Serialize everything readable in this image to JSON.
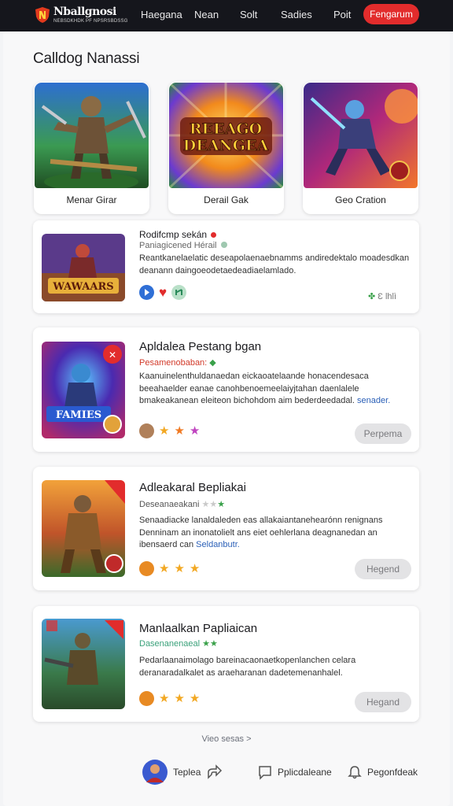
{
  "header": {
    "brand_name": "Nballgnosi",
    "brand_tagline": "NEBSDKHDK PF NPSRSBDSSG",
    "nav": [
      "Haegana",
      "Nean",
      "Solt",
      "Sadies",
      "Poit"
    ],
    "cta_label": "Fengarum"
  },
  "page_title": "Calldog Nanassi",
  "featured": [
    {
      "label": "Menar Girar",
      "art_text": "",
      "icon": "warrior-art"
    },
    {
      "label": "Derail Gak",
      "art_text_line1": "REEAGO",
      "art_text_line2": "DEANGEA",
      "icon": "logo-art"
    },
    {
      "label": "Geo Cration",
      "art_text": "",
      "icon": "knight-art"
    }
  ],
  "cards": [
    {
      "title": "Rodifcmp sekán",
      "subtitle": "Paniagicened Hérail",
      "description": "Reantkanelaelatic deseapolaenaebnamms andiredektalo moadesdkan deanann daingoeodetaedeadiaelamlado.",
      "art_text": "WAWAARS",
      "meta": "Ɛ lhlì",
      "colors": {
        "subtitle": "#666666"
      }
    },
    {
      "title": "Apldalea Pestang bgan",
      "subtitle": "Pesamenobaban:",
      "description": "Kaanuinelenthuldanaedan eickaoatelaande honacendesaca beeahaelder eanae canohbenoemeelaiyjtahan daenlalele bmakeakanean eleiteon bichohdom aim bederdeedadal.",
      "link": "senader.",
      "button": "Perpema",
      "art_text": "FAMIES",
      "colors": {
        "subtitle": "#d23a2a"
      }
    },
    {
      "title": "Adleakaral Bepliakai",
      "subtitle": "Deseanaeakani",
      "description": "Senaadiacke lanaldaleden eas allakaiantanehearónn renignans Denninam an inonatolielt ans eiet oehlerlana deagnanedan an ibensaerd can",
      "link": "Seldanbutr.",
      "button": "Hegend",
      "colors": {
        "subtitle": "#555555"
      }
    },
    {
      "title": "Manlaalkan Papliaican",
      "subtitle": "Dasenanenaeal",
      "description": "Pedarlaanaimolago bareinacaonaetkopenlanchen celara deranaradalkalet as araeharanan dadetemenanhalel.",
      "button": "Hegand",
      "colors": {
        "subtitle": "#3aa17a"
      }
    }
  ],
  "view_all": "Vieo sesas >",
  "bottom_nav": [
    {
      "label": "Teplea",
      "icon": "avatar"
    },
    {
      "label": "Pplicdaleane",
      "icon": "chat-icon"
    },
    {
      "label": "Pegonfdeak",
      "icon": "bell-icon"
    }
  ],
  "colors": {
    "accent": "#e22c2c",
    "header_bg": "#15161c",
    "star": "#f2a823"
  }
}
